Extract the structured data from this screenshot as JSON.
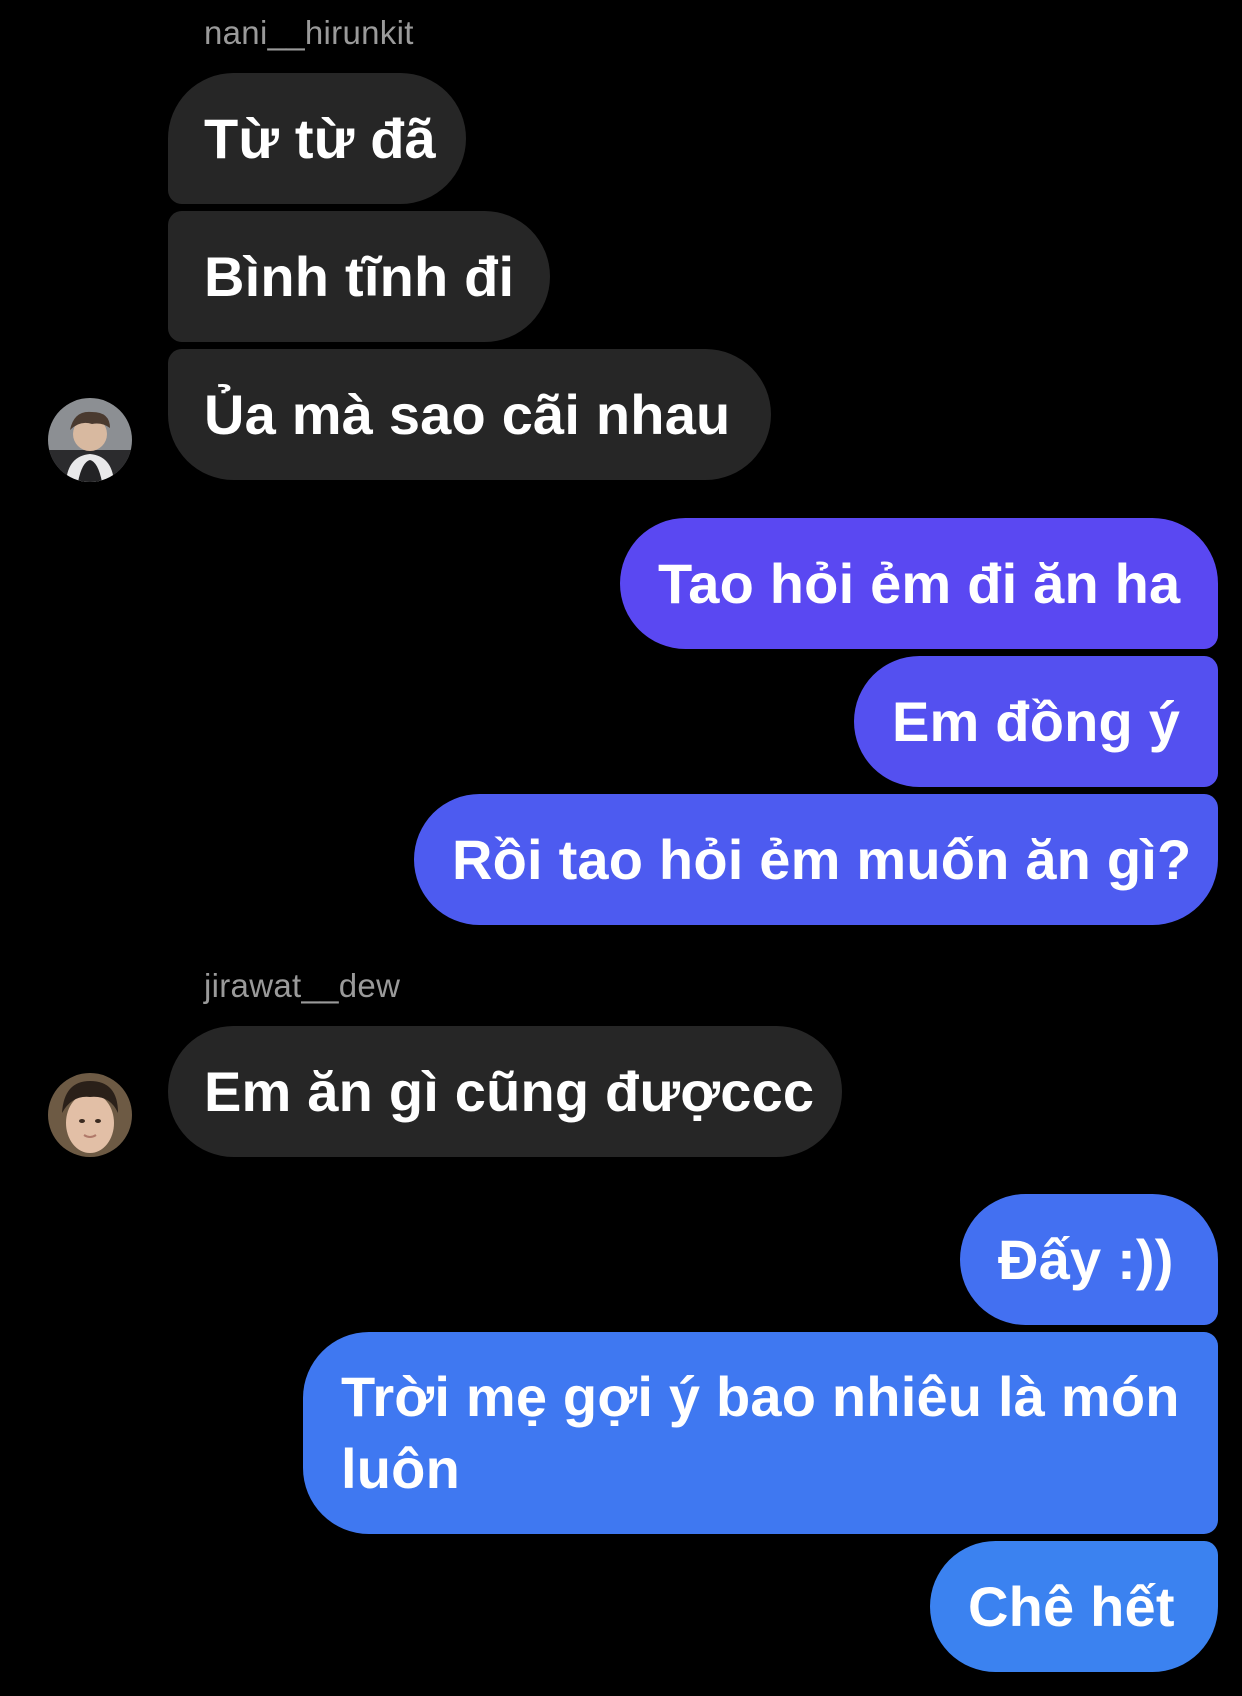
{
  "thread": {
    "groups": [
      {
        "sender": "nani__hirunkit",
        "avatar": "avatar-nani",
        "messages": [
          "Từ từ đã",
          "Bình tĩnh đi",
          "Ủa mà sao cãi nhau"
        ]
      },
      {
        "sender": "me",
        "messages": [
          "Tao hỏi ẻm đi ăn ha",
          "Em đồng ý",
          "Rồi tao hỏi ẻm muốn ăn gì?"
        ]
      },
      {
        "sender": "jirawat__dew",
        "avatar": "avatar-jirawat",
        "messages": [
          "Em ăn gì cũng đượccc"
        ]
      },
      {
        "sender": "me",
        "messages": [
          "Đấy :))",
          "Trời mẹ gợi ý bao nhiêu là món luôn",
          "Chê hết"
        ]
      }
    ]
  },
  "labels": {
    "sender_1": "nani__hirunkit",
    "sender_2": "jirawat__dew"
  },
  "colors": {
    "background": "#000000",
    "incoming_bubble": "#262626",
    "outgoing_gradient_top": "#5a48f0",
    "outgoing_gradient_bottom": "#3b82f0",
    "sender_name": "#9a9a9a"
  }
}
